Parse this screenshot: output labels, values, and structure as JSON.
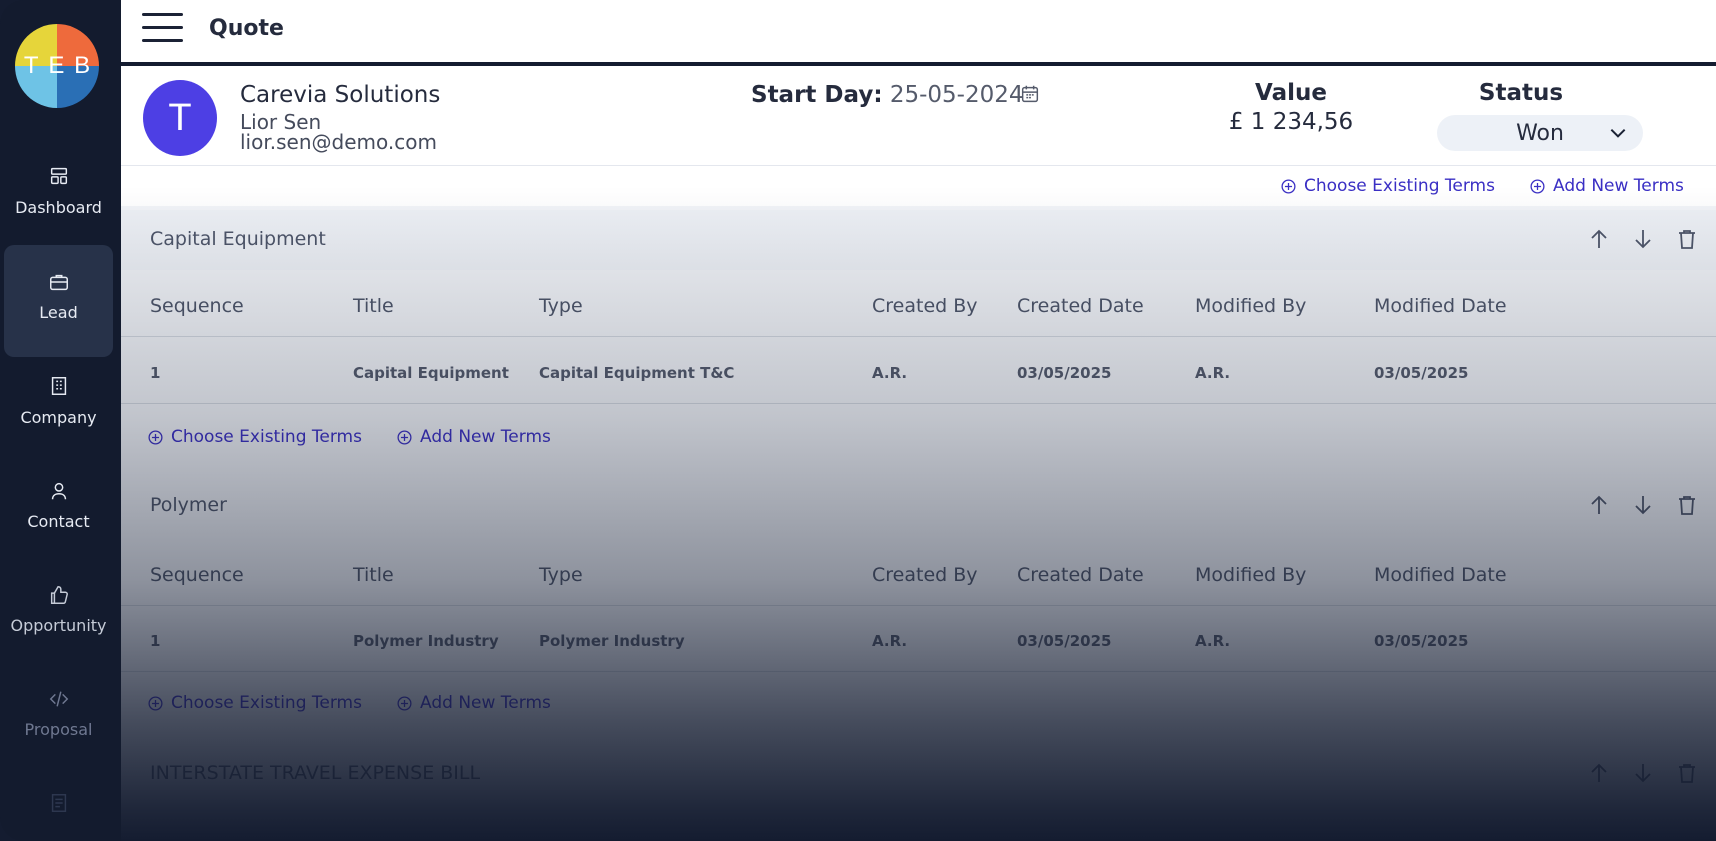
{
  "logo": {
    "letters": [
      "T",
      "E",
      "B"
    ]
  },
  "sidebar": {
    "items": [
      {
        "label": "Dashboard",
        "icon": "dashboard-icon"
      },
      {
        "label": "Lead",
        "icon": "briefcase-icon",
        "active": true
      },
      {
        "label": "Company",
        "icon": "building-icon"
      },
      {
        "label": "Contact",
        "icon": "user-icon"
      },
      {
        "label": "Opportunity",
        "icon": "thumbs-up-icon"
      },
      {
        "label": "Proposal",
        "icon": "code-icon"
      }
    ]
  },
  "header": {
    "title": "Quote"
  },
  "quote": {
    "avatar_letter": "T",
    "customer_name": "Carevia Solutions",
    "contact_name": "Lior Sen",
    "contact_email": "lior.sen@demo.com",
    "start_day_label": "Start Day:",
    "start_day_value": "25-05-2024",
    "value_label": "Value",
    "value_amount": "£ 1 234,56",
    "status_label": "Status",
    "status_value": "Won"
  },
  "links": {
    "choose_existing": "Choose Existing Terms",
    "add_new": "Add New Terms"
  },
  "table_columns": [
    "Sequence",
    "Title",
    "Type",
    "Created By",
    "Created Date",
    "Modified By",
    "Modified Date"
  ],
  "sections": [
    {
      "title": "Capital Equipment",
      "rows": [
        {
          "sequence": "1",
          "title": "Capital Equipment",
          "type": "Capital Equipment T&C",
          "created_by": "A.R.",
          "created_date": "03/05/2025",
          "modified_by": "A.R.",
          "modified_date": "03/05/2025"
        }
      ]
    },
    {
      "title": "Polymer",
      "rows": [
        {
          "sequence": "1",
          "title": "Polymer Industry",
          "type": "Polymer Industry",
          "created_by": "A.R.",
          "created_date": "03/05/2025",
          "modified_by": "A.R.",
          "modified_date": "03/05/2025"
        }
      ]
    },
    {
      "title": "INTERSTATE TRAVEL EXPENSE BILL",
      "rows": []
    }
  ],
  "colors": {
    "sidebar_bg": "#131b2e",
    "active_nav_bg": "#273249",
    "avatar_bg": "#4d3fe4",
    "link_color": "#3a2fc4"
  }
}
